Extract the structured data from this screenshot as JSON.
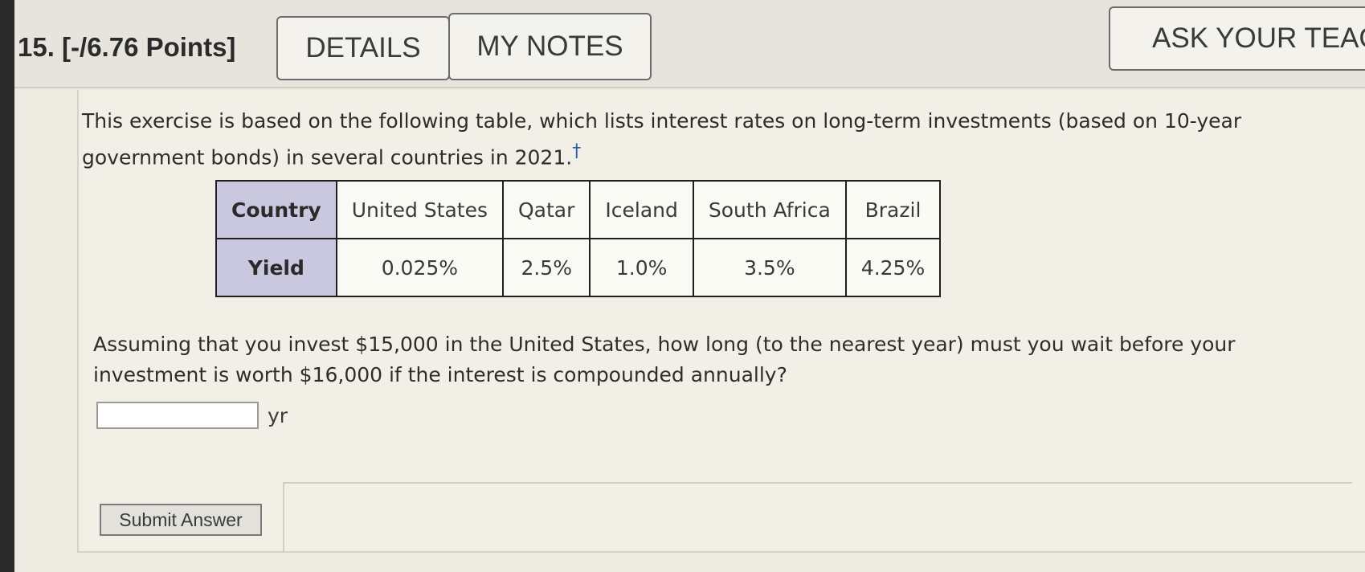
{
  "question": {
    "label": "15. [-/6.76 Points]"
  },
  "toolbar": {
    "details_label": "DETAILS",
    "notes_label": "MY NOTES",
    "ask_label": "ASK YOUR TEACHER"
  },
  "exercise": {
    "intro": "This exercise is based on the following table, which lists interest rates on long-term investments (based on 10-year government bonds) in several countries in 2021.",
    "footnote_marker": "†"
  },
  "table": {
    "header_country": "Country",
    "header_yield": "Yield",
    "columns": [
      {
        "country": "United States",
        "yield": "0.025%"
      },
      {
        "country": "Qatar",
        "yield": "2.5%"
      },
      {
        "country": "Iceland",
        "yield": "1.0%"
      },
      {
        "country": "South Africa",
        "yield": "3.5%"
      },
      {
        "country": "Brazil",
        "yield": "4.25%"
      }
    ]
  },
  "prompt": {
    "text": "Assuming that you invest $15,000 in the United States, how long (to the nearest year) must you wait before your investment is worth $16,000 if the interest is compounded annually?"
  },
  "answer": {
    "value": "",
    "unit": "yr"
  },
  "submit": {
    "label": "Submit Answer"
  }
}
